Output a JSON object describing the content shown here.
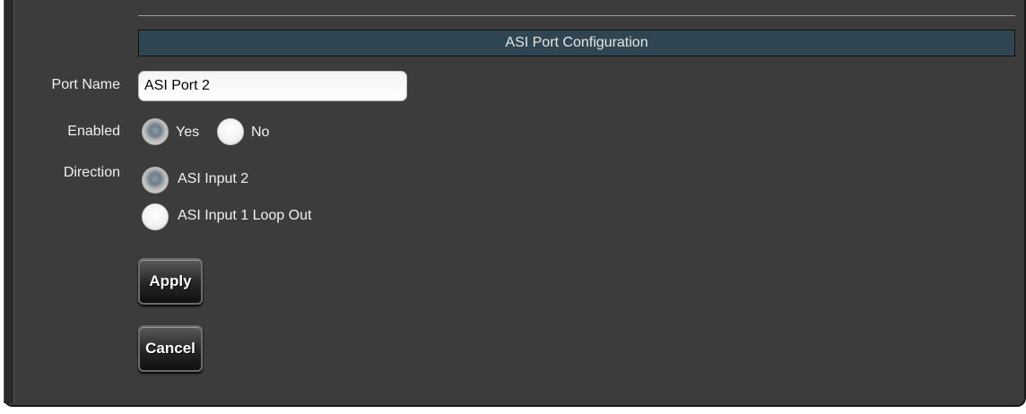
{
  "section": {
    "title": "ASI Port Configuration"
  },
  "fields": {
    "port_name": {
      "label": "Port Name",
      "value": "ASI Port 2"
    },
    "enabled": {
      "label": "Enabled",
      "options": [
        {
          "label": "Yes",
          "checked": true
        },
        {
          "label": "No",
          "checked": false
        }
      ]
    },
    "direction": {
      "label": "Direction",
      "options": [
        {
          "label": "ASI Input 2",
          "checked": true
        },
        {
          "label": "ASI Input 1 Loop Out",
          "checked": false
        }
      ]
    }
  },
  "actions": {
    "apply_label": "Apply",
    "cancel_label": "Cancel"
  }
}
